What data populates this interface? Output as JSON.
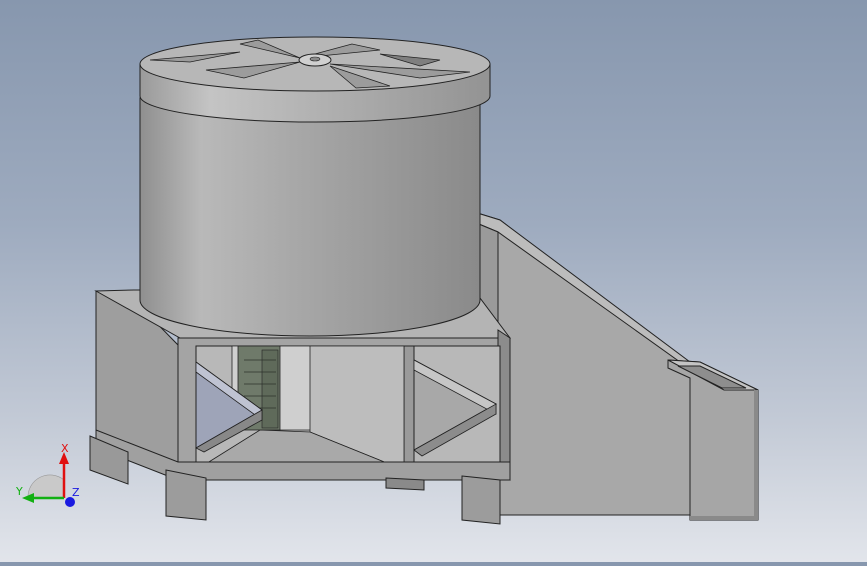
{
  "view": {
    "model": "mixer-assembly",
    "background_top": "#8797ae",
    "background_bottom": "#e2e5eb",
    "body_color": "#a9a9a9"
  },
  "triad": {
    "x_label": "X",
    "y_label": "Y",
    "z_label": "Z",
    "x_color": "#e01010",
    "y_color": "#12b012",
    "z_color": "#1a1ae0"
  }
}
